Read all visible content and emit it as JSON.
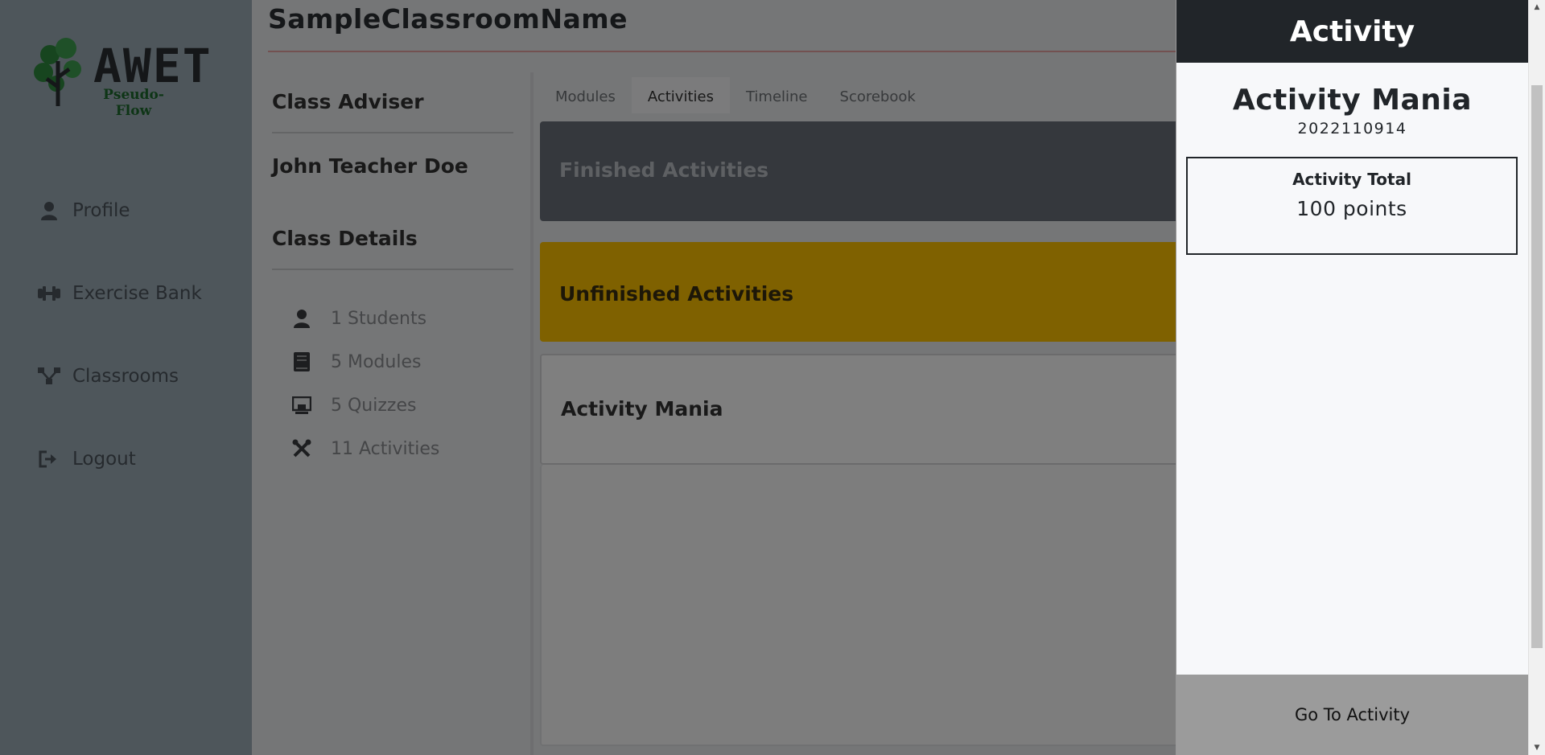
{
  "app": {
    "logo": {
      "word": "AWET",
      "subtitle": "Pseudo-Flow"
    },
    "nav": [
      {
        "label": "Profile",
        "icon": "user-icon"
      },
      {
        "label": "Exercise Bank",
        "icon": "dumbbell-icon"
      },
      {
        "label": "Classrooms",
        "icon": "network-icon"
      },
      {
        "label": "Logout",
        "icon": "logout-icon"
      }
    ]
  },
  "classroom": {
    "title": "SampleClassroomName",
    "adviser_heading": "Class Adviser",
    "adviser_name": "John Teacher Doe",
    "details_heading": "Class Details",
    "stats": [
      {
        "label": "1 Students",
        "icon": "user-icon"
      },
      {
        "label": "5 Modules",
        "icon": "book-icon"
      },
      {
        "label": "5 Quizzes",
        "icon": "quiz-icon"
      },
      {
        "label": "11 Activities",
        "icon": "tools-icon"
      }
    ],
    "tabs": [
      "Modules",
      "Activities",
      "Timeline",
      "Scorebook"
    ],
    "active_tab": "Activities",
    "finished_label": "Finished Activities",
    "unfinished_label": "Unfinished Activities",
    "activity_item": "Activity Mania"
  },
  "drawer": {
    "title": "Activity",
    "activity_name": "Activity Mania",
    "activity_code": "2022110914",
    "total_label": "Activity Total",
    "total_value": "100 points",
    "footer_button": "Go To Activity"
  },
  "colors": {
    "drawer_header": "#212529",
    "unfinished": "#ffc300",
    "finished": "#6a717a",
    "footer": "#9b9b9b"
  }
}
